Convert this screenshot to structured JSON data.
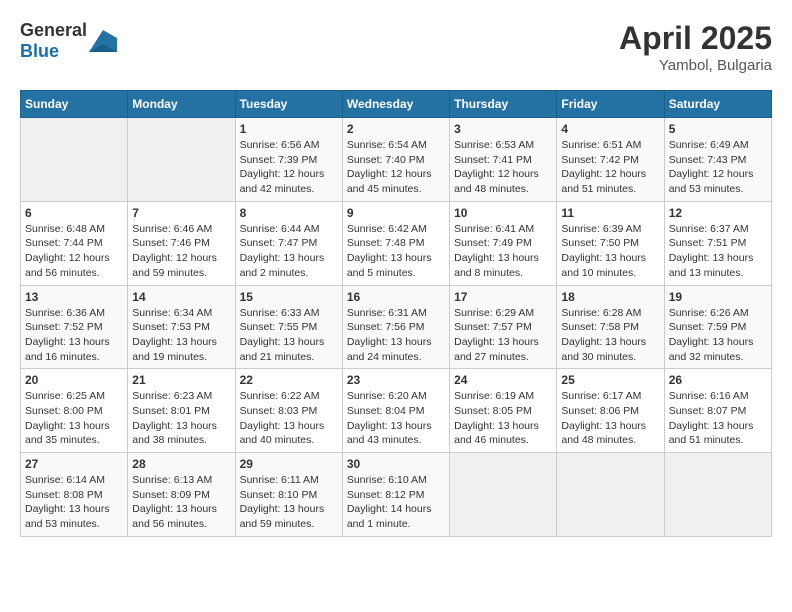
{
  "header": {
    "logo_general": "General",
    "logo_blue": "Blue",
    "title": "April 2025",
    "location": "Yambol, Bulgaria"
  },
  "days_of_week": [
    "Sunday",
    "Monday",
    "Tuesday",
    "Wednesday",
    "Thursday",
    "Friday",
    "Saturday"
  ],
  "weeks": [
    [
      {
        "day": "",
        "info": ""
      },
      {
        "day": "",
        "info": ""
      },
      {
        "day": "1",
        "info": "Sunrise: 6:56 AM\nSunset: 7:39 PM\nDaylight: 12 hours and 42 minutes."
      },
      {
        "day": "2",
        "info": "Sunrise: 6:54 AM\nSunset: 7:40 PM\nDaylight: 12 hours and 45 minutes."
      },
      {
        "day": "3",
        "info": "Sunrise: 6:53 AM\nSunset: 7:41 PM\nDaylight: 12 hours and 48 minutes."
      },
      {
        "day": "4",
        "info": "Sunrise: 6:51 AM\nSunset: 7:42 PM\nDaylight: 12 hours and 51 minutes."
      },
      {
        "day": "5",
        "info": "Sunrise: 6:49 AM\nSunset: 7:43 PM\nDaylight: 12 hours and 53 minutes."
      }
    ],
    [
      {
        "day": "6",
        "info": "Sunrise: 6:48 AM\nSunset: 7:44 PM\nDaylight: 12 hours and 56 minutes."
      },
      {
        "day": "7",
        "info": "Sunrise: 6:46 AM\nSunset: 7:46 PM\nDaylight: 12 hours and 59 minutes."
      },
      {
        "day": "8",
        "info": "Sunrise: 6:44 AM\nSunset: 7:47 PM\nDaylight: 13 hours and 2 minutes."
      },
      {
        "day": "9",
        "info": "Sunrise: 6:42 AM\nSunset: 7:48 PM\nDaylight: 13 hours and 5 minutes."
      },
      {
        "day": "10",
        "info": "Sunrise: 6:41 AM\nSunset: 7:49 PM\nDaylight: 13 hours and 8 minutes."
      },
      {
        "day": "11",
        "info": "Sunrise: 6:39 AM\nSunset: 7:50 PM\nDaylight: 13 hours and 10 minutes."
      },
      {
        "day": "12",
        "info": "Sunrise: 6:37 AM\nSunset: 7:51 PM\nDaylight: 13 hours and 13 minutes."
      }
    ],
    [
      {
        "day": "13",
        "info": "Sunrise: 6:36 AM\nSunset: 7:52 PM\nDaylight: 13 hours and 16 minutes."
      },
      {
        "day": "14",
        "info": "Sunrise: 6:34 AM\nSunset: 7:53 PM\nDaylight: 13 hours and 19 minutes."
      },
      {
        "day": "15",
        "info": "Sunrise: 6:33 AM\nSunset: 7:55 PM\nDaylight: 13 hours and 21 minutes."
      },
      {
        "day": "16",
        "info": "Sunrise: 6:31 AM\nSunset: 7:56 PM\nDaylight: 13 hours and 24 minutes."
      },
      {
        "day": "17",
        "info": "Sunrise: 6:29 AM\nSunset: 7:57 PM\nDaylight: 13 hours and 27 minutes."
      },
      {
        "day": "18",
        "info": "Sunrise: 6:28 AM\nSunset: 7:58 PM\nDaylight: 13 hours and 30 minutes."
      },
      {
        "day": "19",
        "info": "Sunrise: 6:26 AM\nSunset: 7:59 PM\nDaylight: 13 hours and 32 minutes."
      }
    ],
    [
      {
        "day": "20",
        "info": "Sunrise: 6:25 AM\nSunset: 8:00 PM\nDaylight: 13 hours and 35 minutes."
      },
      {
        "day": "21",
        "info": "Sunrise: 6:23 AM\nSunset: 8:01 PM\nDaylight: 13 hours and 38 minutes."
      },
      {
        "day": "22",
        "info": "Sunrise: 6:22 AM\nSunset: 8:03 PM\nDaylight: 13 hours and 40 minutes."
      },
      {
        "day": "23",
        "info": "Sunrise: 6:20 AM\nSunset: 8:04 PM\nDaylight: 13 hours and 43 minutes."
      },
      {
        "day": "24",
        "info": "Sunrise: 6:19 AM\nSunset: 8:05 PM\nDaylight: 13 hours and 46 minutes."
      },
      {
        "day": "25",
        "info": "Sunrise: 6:17 AM\nSunset: 8:06 PM\nDaylight: 13 hours and 48 minutes."
      },
      {
        "day": "26",
        "info": "Sunrise: 6:16 AM\nSunset: 8:07 PM\nDaylight: 13 hours and 51 minutes."
      }
    ],
    [
      {
        "day": "27",
        "info": "Sunrise: 6:14 AM\nSunset: 8:08 PM\nDaylight: 13 hours and 53 minutes."
      },
      {
        "day": "28",
        "info": "Sunrise: 6:13 AM\nSunset: 8:09 PM\nDaylight: 13 hours and 56 minutes."
      },
      {
        "day": "29",
        "info": "Sunrise: 6:11 AM\nSunset: 8:10 PM\nDaylight: 13 hours and 59 minutes."
      },
      {
        "day": "30",
        "info": "Sunrise: 6:10 AM\nSunset: 8:12 PM\nDaylight: 14 hours and 1 minute."
      },
      {
        "day": "",
        "info": ""
      },
      {
        "day": "",
        "info": ""
      },
      {
        "day": "",
        "info": ""
      }
    ]
  ]
}
